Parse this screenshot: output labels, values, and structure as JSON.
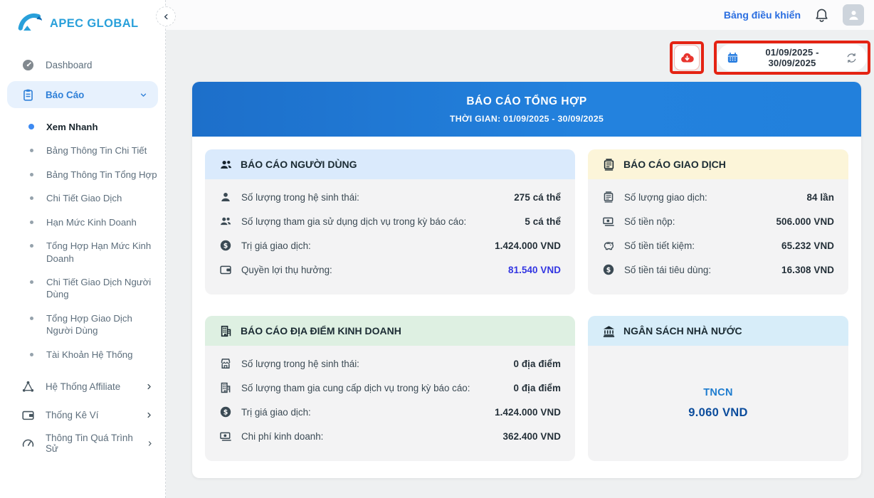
{
  "brand": {
    "name": "APEC GLOBAL"
  },
  "topbar": {
    "dashboard_link": "Bảng điều khiển"
  },
  "toolbar": {
    "date_range": "01/09/2025 - 30/09/2025"
  },
  "sidebar": {
    "items": [
      {
        "label": "Dashboard",
        "icon": "gauge"
      },
      {
        "label": "Báo Cáo",
        "icon": "clipboard",
        "state": "active-expanded"
      }
    ],
    "report_children": [
      {
        "label": "Xem Nhanh",
        "active": true
      },
      {
        "label": "Bảng Thông Tin Chi Tiết"
      },
      {
        "label": "Bảng Thông Tin Tổng Hợp"
      },
      {
        "label": "Chi Tiết Giao Dịch"
      },
      {
        "label": "Hạn Mức Kinh Doanh"
      },
      {
        "label": "Tổng Hợp Hạn Mức Kinh Doanh"
      },
      {
        "label": "Chi Tiết Giao Dịch Người Dùng"
      },
      {
        "label": "Tổng Hợp Giao Dịch Người Dùng"
      },
      {
        "label": "Tài Khoản Hệ Thống"
      }
    ],
    "bottom_items": [
      {
        "label": "Hệ Thống Affiliate",
        "icon": "network"
      },
      {
        "label": "Thống Kê Ví",
        "icon": "wallet"
      },
      {
        "label": "Thông Tin Quá Trình Sử",
        "icon": "gauge"
      }
    ]
  },
  "banner": {
    "title": "BÁO CÁO TỔNG HỢP",
    "subtitle": "THỜI GIAN: 01/09/2025 - 30/09/2025"
  },
  "cards": [
    {
      "title": "BÁO CÁO NGƯỜI DÙNG",
      "icon": "users",
      "rows": [
        {
          "icon": "user",
          "label": "Số lượng trong hệ sinh thái:",
          "value": "275 cá thể"
        },
        {
          "icon": "users",
          "label": "Số lượng tham gia sử dụng dịch vụ trong kỳ báo cáo:",
          "value": "5 cá thể"
        },
        {
          "icon": "dollar-circle",
          "label": "Trị giá giao dịch:",
          "value": "1.424.000 VND"
        },
        {
          "icon": "wallet",
          "label": "Quyền lợi thụ hưởng:",
          "value": "81.540 VND",
          "highlighted": true
        }
      ]
    },
    {
      "title": "BÁO CÁO GIAO DỊCH",
      "icon": "receipt",
      "rows": [
        {
          "icon": "receipt",
          "label": "Số lượng giao dịch:",
          "value": "84 lần"
        },
        {
          "icon": "banknote",
          "label": "Số tiền nộp:",
          "value": "506.000 VND"
        },
        {
          "icon": "piggy-bank",
          "label": "Số tiền tiết kiệm:",
          "value": "65.232 VND"
        },
        {
          "icon": "dollar-circle",
          "label": "Số tiền tái tiêu dùng:",
          "value": "16.308 VND"
        }
      ]
    },
    {
      "title": "BÁO CÁO ĐỊA ĐIỂM KINH DOANH",
      "icon": "building",
      "rows": [
        {
          "icon": "storefront",
          "label": "Số lượng trong hệ sinh thái:",
          "value": "0 địa điểm"
        },
        {
          "icon": "building",
          "label": "Số lượng tham gia cung cấp dịch vụ trong kỳ báo cáo:",
          "value": "0 địa điểm"
        },
        {
          "icon": "dollar-circle",
          "label": "Trị giá giao dịch:",
          "value": "1.424.000 VND"
        },
        {
          "icon": "banknote",
          "label": "Chi phí kinh doanh:",
          "value": "362.400 VND"
        }
      ]
    },
    {
      "title": "NGÂN SÁCH NHÀ NƯỚC",
      "icon": "bank",
      "center": {
        "label": "TNCN",
        "value": "9.060 VND"
      }
    }
  ],
  "colors": {
    "banner_blue": "#2079d6",
    "annotation_red": "#e42313",
    "highlight_value_blue": "#3235e2",
    "tncn_label_blue": "#1e7ccf",
    "tncn_value_blue": "#0b4c9c",
    "card_header_user": "#daeafc",
    "card_header_transaction": "#fcf5d9",
    "card_header_location": "#def0e2",
    "card_header_budget": "#d7edf9",
    "brand_blue": "#29a0da",
    "active_item_blue": "#2f80d8",
    "export_icon_red": "#e8352e"
  }
}
